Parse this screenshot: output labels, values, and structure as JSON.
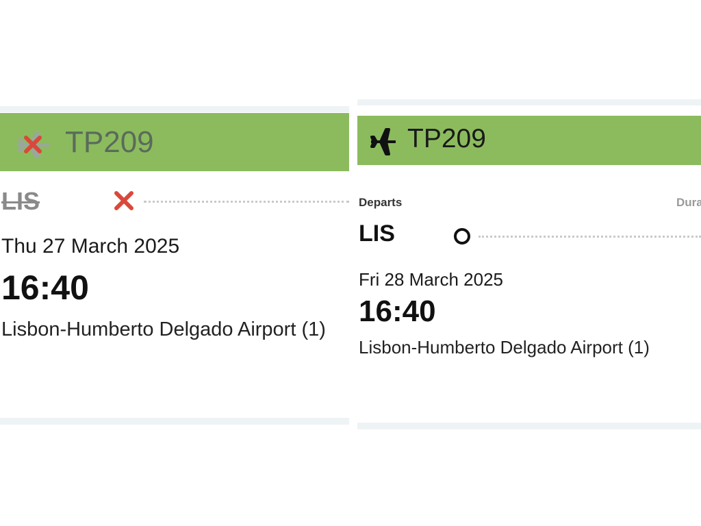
{
  "cancelled_flight": {
    "flight_number": "TP209",
    "departure_code": "LIS",
    "date": "Thu 27 March 2025",
    "time": "16:40",
    "airport_name": "Lisbon-Humberto Delgado Airport (1)",
    "status": "cancelled",
    "header_color": "#8cbb5e",
    "cancel_color": "#d9493b",
    "plane_icon": "airplane-icon",
    "status_icon": "cross-icon"
  },
  "rebooked_flight": {
    "flight_number": "TP209",
    "departs_label": "Departs",
    "duration_label": "Dura",
    "departure_code": "LIS",
    "date": "Fri 28 March 2025",
    "time": "16:40",
    "airport_name": "Lisbon-Humberto Delgado Airport (1)",
    "header_color": "#8cbb5e",
    "plane_icon": "airplane-icon",
    "status_icon": "circle-icon"
  }
}
